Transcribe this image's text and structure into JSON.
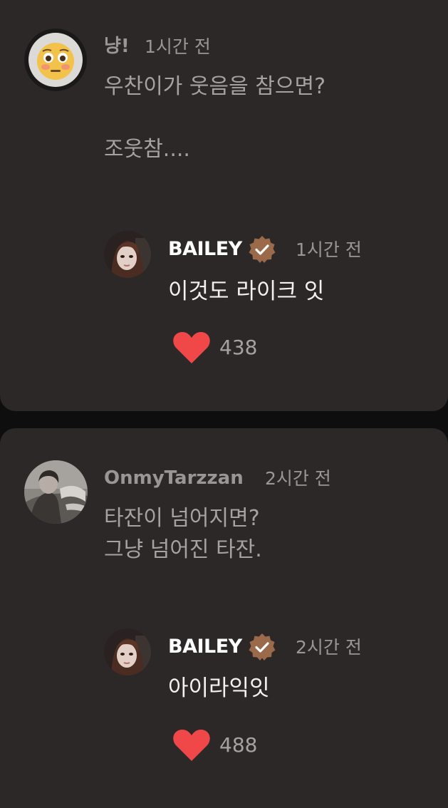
{
  "comments": [
    {
      "author": "냥!",
      "time": "1시간 전",
      "text": "우찬이가 웃음을 참으면?\n\n조웃참....",
      "avatar_icon": "flushed-face-emoji",
      "reply": {
        "author": "BAILEY",
        "verified": true,
        "time": "1시간 전",
        "text": "이것도 라이크 잇",
        "likes": "438"
      }
    },
    {
      "author": "OnmyTarzzan",
      "time": "2시간 전",
      "text": "타잔이 넘어지면?\n그냥 넘어진 타잔.",
      "avatar_icon": "profile-photo",
      "reply": {
        "author": "BAILEY",
        "verified": true,
        "time": "2시간 전",
        "text": "아이라익잇",
        "likes": "488"
      }
    }
  ],
  "colors": {
    "background": "#0f0e0e",
    "card": "#2c2828",
    "heart": "#f04848",
    "badge": "#9b6a4a",
    "muted_text": "#9a9696",
    "reply_text": "#ffffff"
  }
}
